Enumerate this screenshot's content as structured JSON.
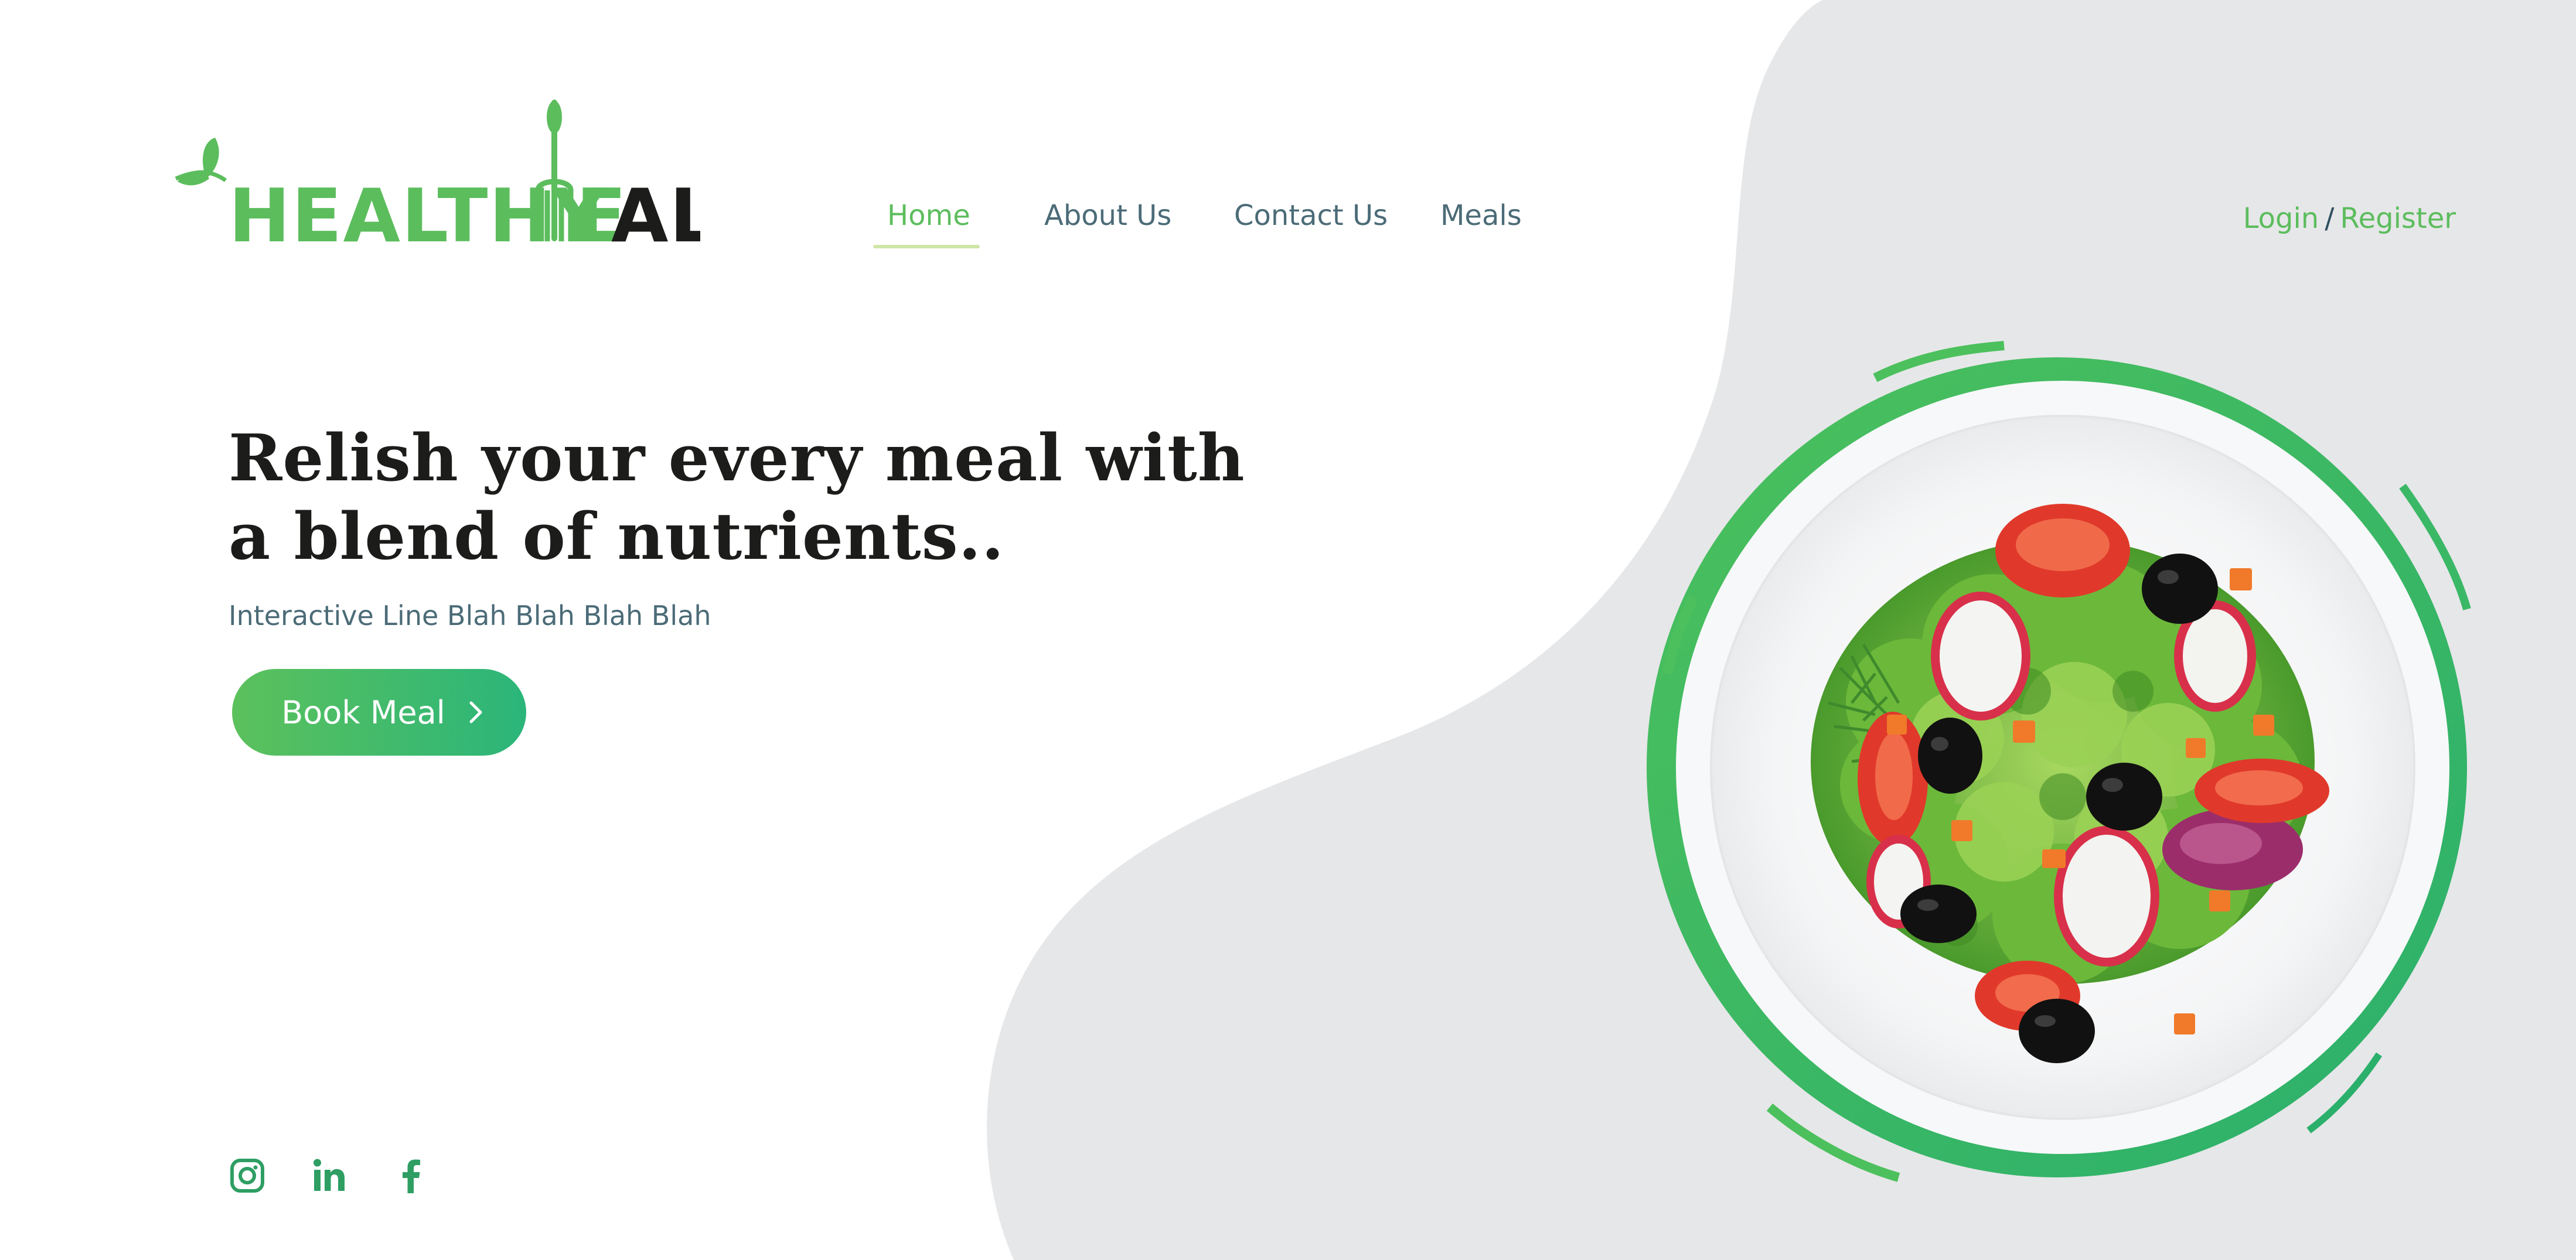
{
  "brand": {
    "logo_part_green": "HEALTHY",
    "logo_part_green_2": "E",
    "logo_part_dark": "AL",
    "logo_alt": "HEALTHY MEAL",
    "primary_color": "#5cbd5d",
    "dark_color": "#1c1c1a"
  },
  "nav": {
    "items": [
      {
        "label": "Home",
        "active": true
      },
      {
        "label": "About Us",
        "active": false
      },
      {
        "label": "Contact Us",
        "active": false
      },
      {
        "label": "Meals",
        "active": false
      }
    ]
  },
  "auth": {
    "login": "Login",
    "separator": "/",
    "register": "Register"
  },
  "hero": {
    "headline_line1": "Relish your every meal with",
    "headline_line2": "a blend of nutrients..",
    "subline": "Interactive Line Blah Blah Blah Blah",
    "cta_label": "Book Meal",
    "cta_icon": "chevron-right-icon"
  },
  "social": {
    "icons": [
      "instagram-icon",
      "linkedin-icon",
      "facebook-icon"
    ],
    "color": "#2e9e63"
  },
  "visual": {
    "background_blob_color": "#e6e7e9",
    "image": "salad-plate"
  }
}
